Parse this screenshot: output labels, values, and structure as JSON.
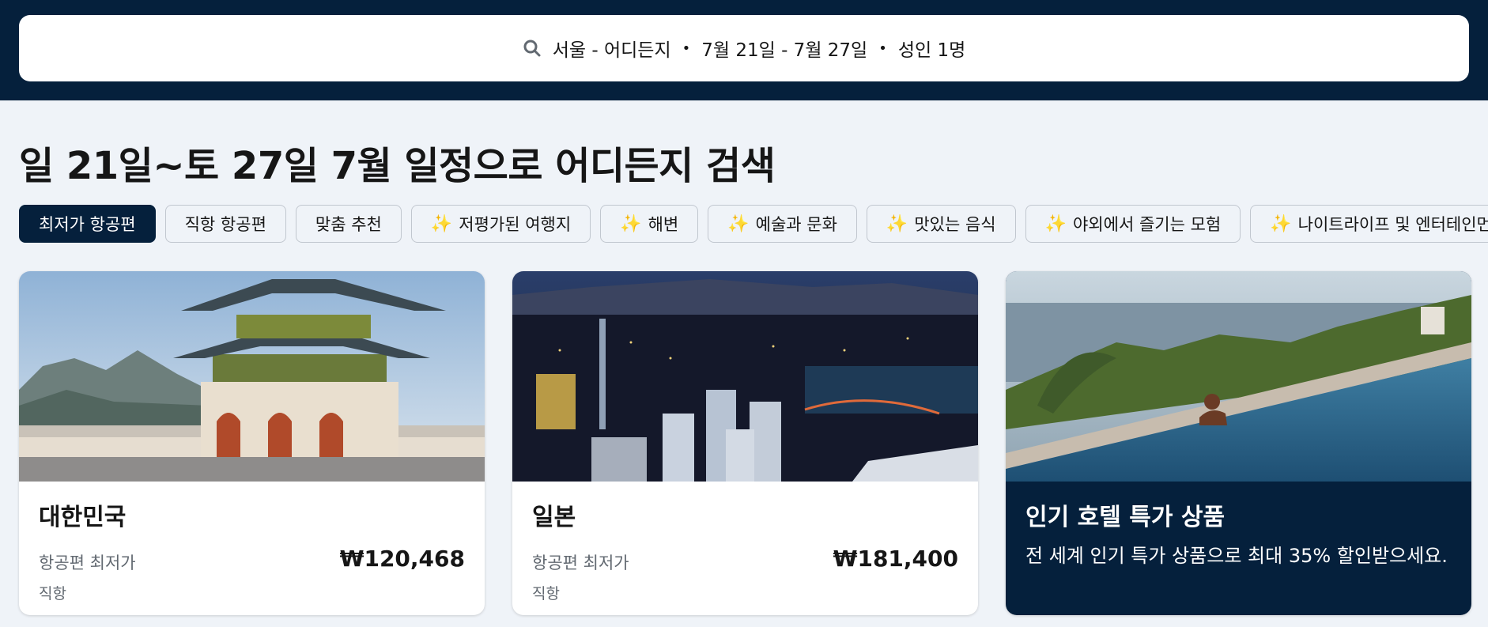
{
  "search": {
    "route": "서울 - 어디든지",
    "dates": "7월 21일 - 7월 27일",
    "travellers": "성인 1명",
    "separator": "•"
  },
  "page_title": "일 21일~토 27일 7월 일정으로 어디든지 검색",
  "chips": [
    {
      "label": "최저가 항공편",
      "active": true,
      "sparkle": false
    },
    {
      "label": "직항 항공편",
      "active": false,
      "sparkle": false
    },
    {
      "label": "맞춤 추천",
      "active": false,
      "sparkle": false
    },
    {
      "label": "저평가된 여행지",
      "active": false,
      "sparkle": true
    },
    {
      "label": "해변",
      "active": false,
      "sparkle": true
    },
    {
      "label": "예술과 문화",
      "active": false,
      "sparkle": true
    },
    {
      "label": "맛있는 음식",
      "active": false,
      "sparkle": true
    },
    {
      "label": "야외에서 즐기는 모험",
      "active": false,
      "sparkle": true
    },
    {
      "label": "나이트라이프 및 엔터테인먼트",
      "active": false,
      "sparkle": true
    }
  ],
  "sparkle_glyph": "✨",
  "cards": [
    {
      "country": "대한민국",
      "sub": "항공편 최저가",
      "price": "₩120,468",
      "type": "직항"
    },
    {
      "country": "일본",
      "sub": "항공편 최저가",
      "price": "₩181,400",
      "type": "직항"
    }
  ],
  "promo": {
    "title": "인기 호텔 특가 상품",
    "desc": "전 세계 인기 특가 상품으로 최대 35% 할인받으세요."
  },
  "colors": {
    "navy": "#05203c",
    "page_bg": "#eff3f8",
    "text_muted": "#626971",
    "sparkle": "#f5b700"
  },
  "icons": {
    "search": "search-icon"
  }
}
